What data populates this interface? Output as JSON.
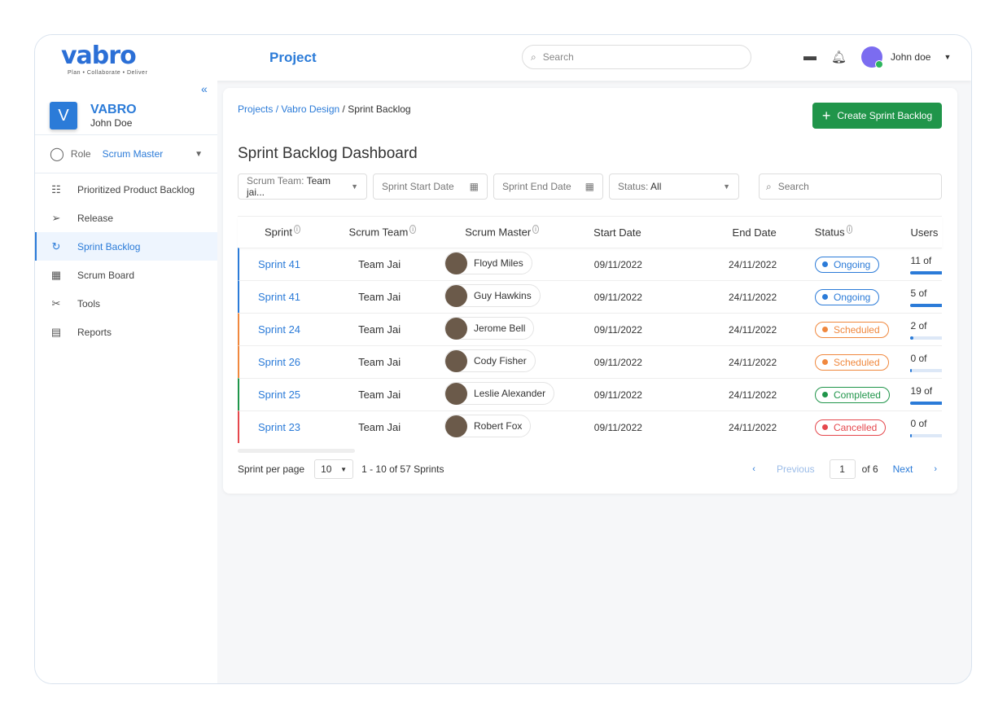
{
  "header": {
    "logo": "vabro",
    "tagline": "Plan • Collaborate • Deliver",
    "title": "Project",
    "search_placeholder": "Search",
    "user": "John doe"
  },
  "sidebar": {
    "workspace_initial": "V",
    "workspace": "VABRO",
    "user": "John Doe",
    "role_label": "Role",
    "role_value": "Scrum Master",
    "items": [
      {
        "label": "Prioritized Product Backlog",
        "icon": "backlog-icon"
      },
      {
        "label": "Release",
        "icon": "send-icon"
      },
      {
        "label": "Sprint Backlog",
        "icon": "sprint-icon",
        "active": true
      },
      {
        "label": "Scrum Board",
        "icon": "calendar-icon"
      },
      {
        "label": "Tools",
        "icon": "tools-icon"
      },
      {
        "label": "Reports",
        "icon": "reports-icon"
      }
    ]
  },
  "breadcrumb": {
    "projects": "Projects",
    "project": "Vabro Design",
    "current": "Sprint Backlog"
  },
  "create_button": "Create Sprint Backlog",
  "page_title": "Sprint Backlog Dashboard",
  "filters": {
    "team_label": "Scrum Team:",
    "team_value": "Team jai...",
    "start": "Sprint Start Date",
    "end": "Sprint End Date",
    "status_label": "Status:",
    "status_value": "All",
    "search_placeholder": "Search"
  },
  "table": {
    "columns": [
      "Sprint",
      "Scrum Team",
      "Scrum Master",
      "Start Date",
      "End Date",
      "Status",
      "Users"
    ],
    "rows": [
      {
        "sprint": "Sprint 41",
        "team": "Team Jai",
        "master": "Floyd Miles",
        "start": "09/11/2022",
        "end": "24/11/2022",
        "status": "Ongoing",
        "users": "11 of",
        "progress": 100
      },
      {
        "sprint": "Sprint 41",
        "team": "Team Jai",
        "master": "Guy Hawkins",
        "start": "09/11/2022",
        "end": "24/11/2022",
        "status": "Ongoing",
        "users": "5 of",
        "progress": 100
      },
      {
        "sprint": "Sprint 24",
        "team": "Team Jai",
        "master": "Jerome Bell",
        "start": "09/11/2022",
        "end": "24/11/2022",
        "status": "Scheduled",
        "users": "2 of",
        "progress": 10
      },
      {
        "sprint": "Sprint 26",
        "team": "Team Jai",
        "master": "Cody Fisher",
        "start": "09/11/2022",
        "end": "24/11/2022",
        "status": "Scheduled",
        "users": "0 of",
        "progress": 5
      },
      {
        "sprint": "Sprint 25",
        "team": "Team Jai",
        "master": "Leslie Alexander",
        "start": "09/11/2022",
        "end": "24/11/2022",
        "status": "Completed",
        "users": "19 of",
        "progress": 100
      },
      {
        "sprint": "Sprint 23",
        "team": "Team Jai",
        "master": "Robert Fox",
        "start": "09/11/2022",
        "end": "24/11/2022",
        "status": "Cancelled",
        "users": "0 of",
        "progress": 5
      }
    ]
  },
  "status_colors": {
    "Ongoing": "#2b7bd8",
    "Scheduled": "#f0883e",
    "Completed": "#20954a",
    "Cancelled": "#e5484d"
  },
  "pagination": {
    "per_page_label": "Sprint per page",
    "per_page": "10",
    "range": "1 - 10 of 57 Sprints",
    "previous": "Previous",
    "page": "1",
    "of": "of 6",
    "next": "Next"
  }
}
